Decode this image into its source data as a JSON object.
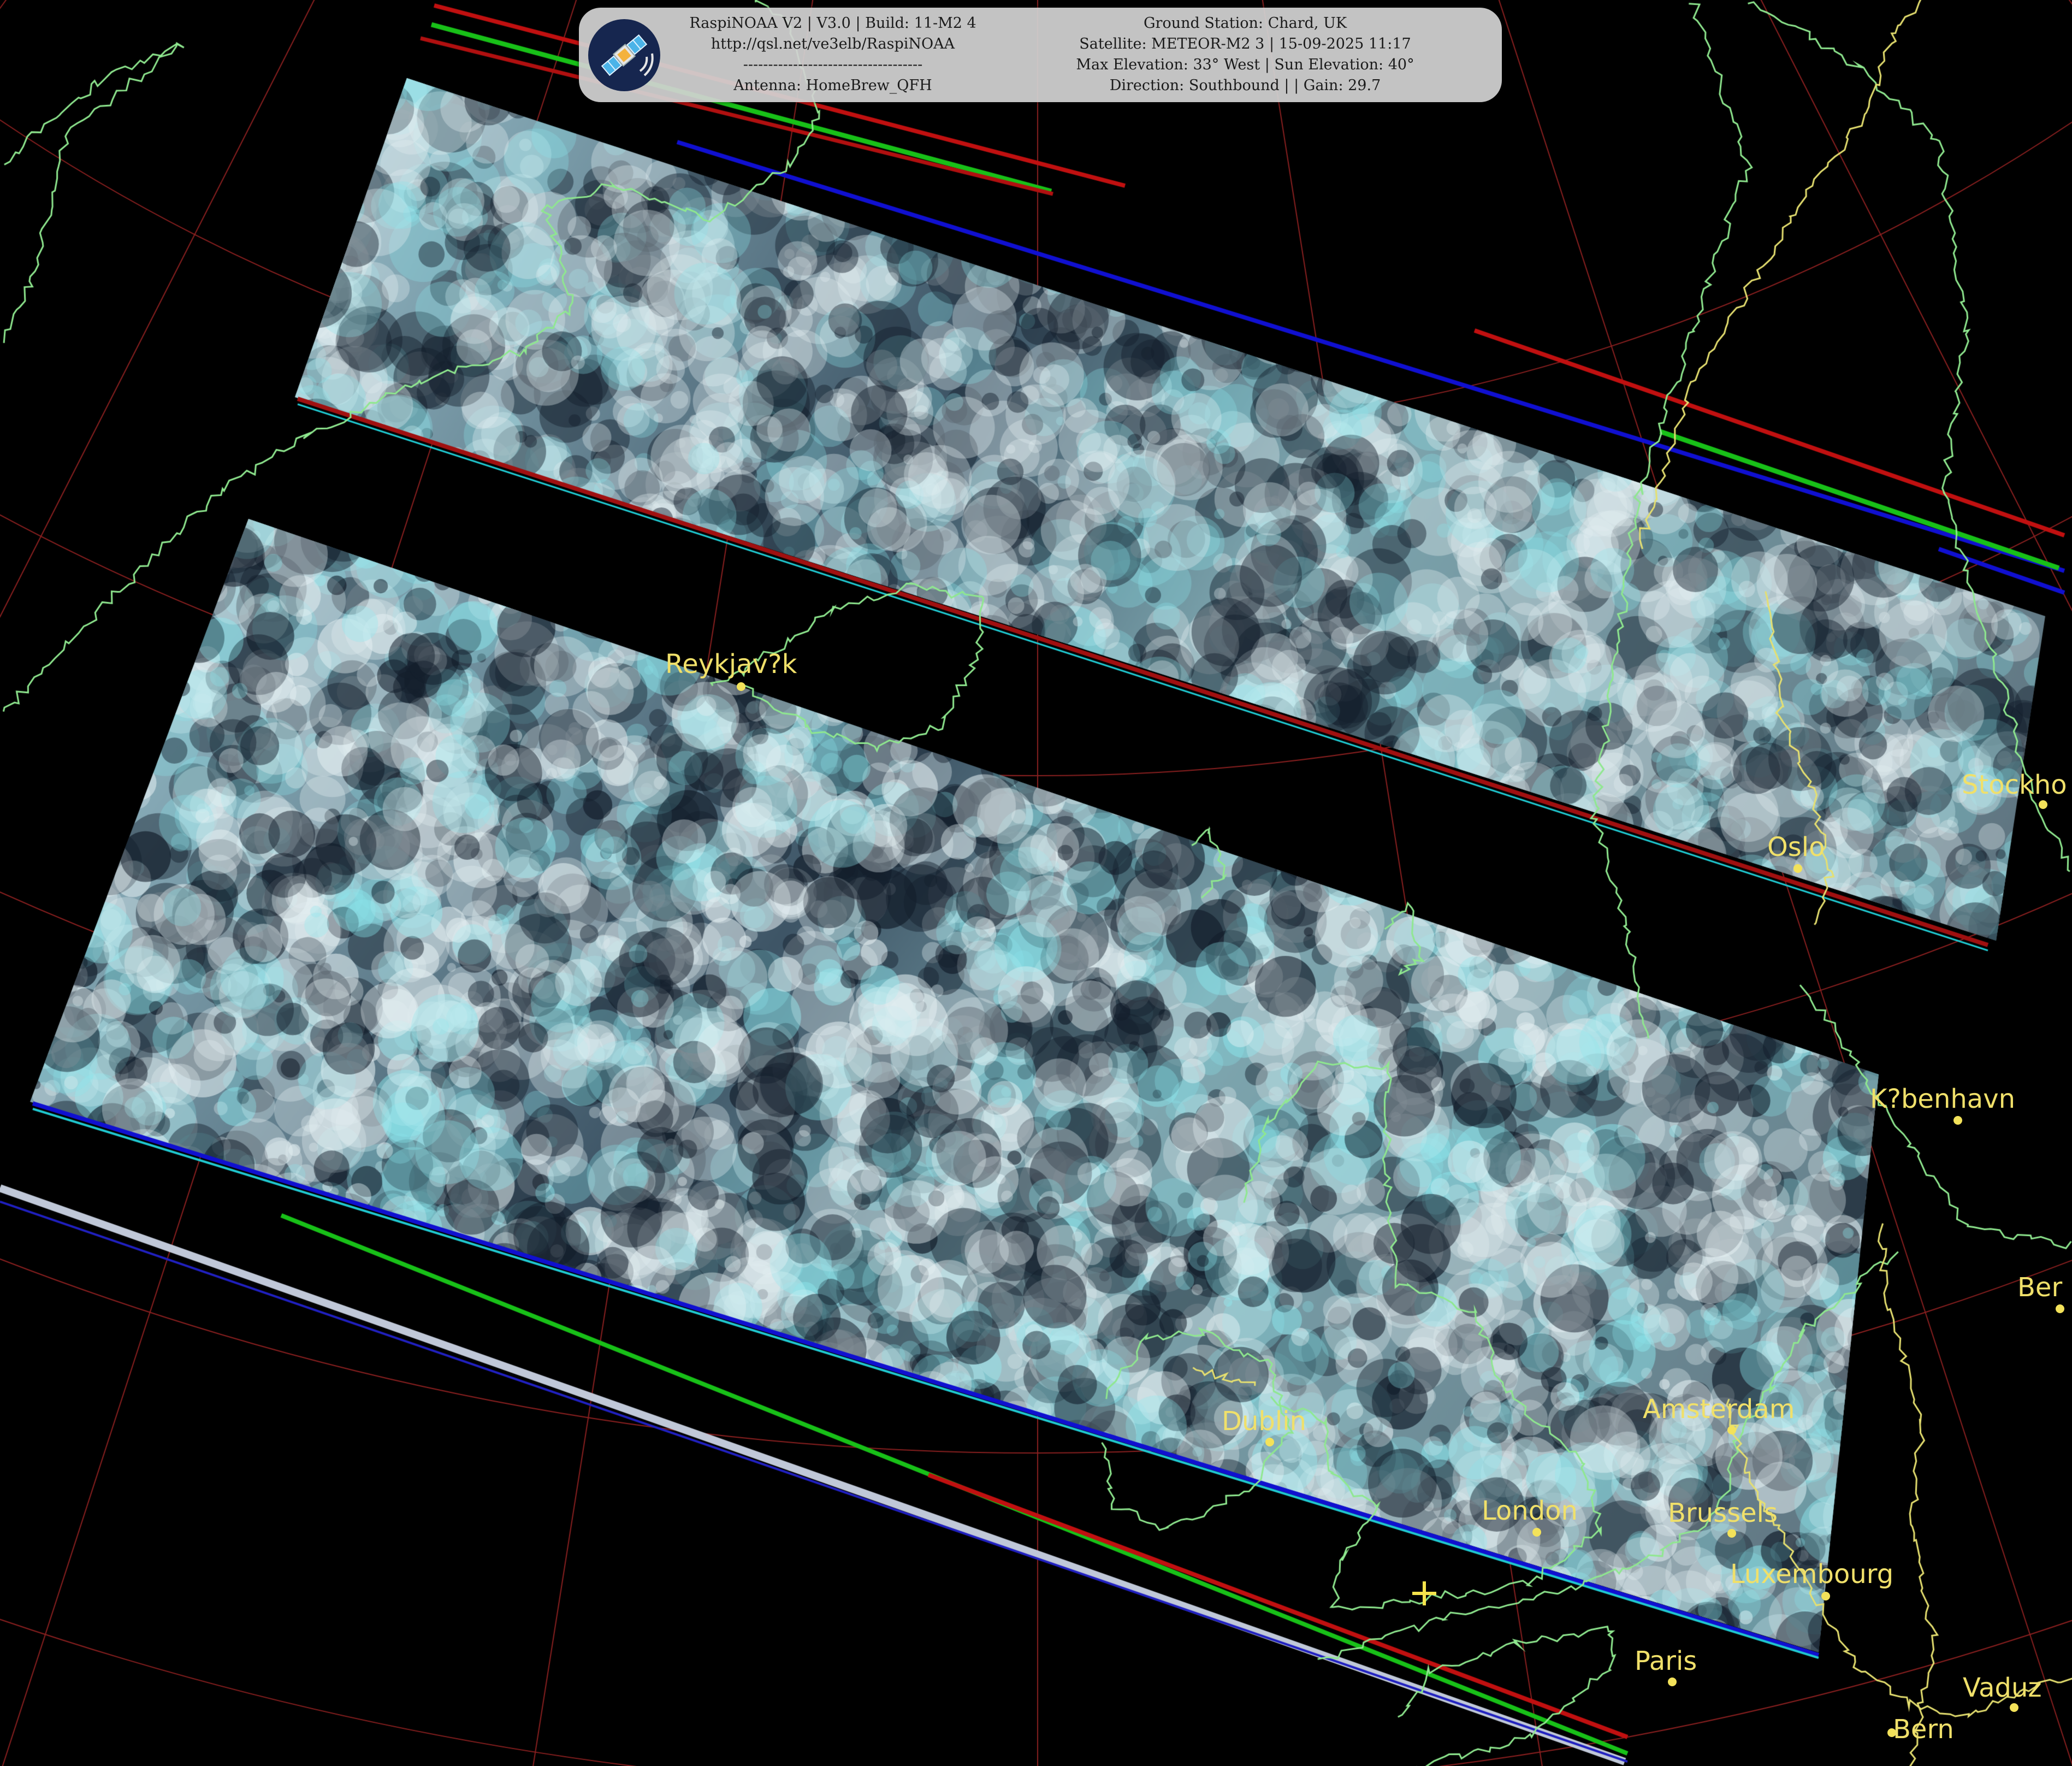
{
  "info_panel": {
    "left_lines": [
      "RaspiNOAA V2 | V3.0 | Build: 11-M2 4",
      "http://qsl.net/ve3elb/RaspiNOAA",
      "------------------------------------",
      "Antenna: HomeBrew_QFH"
    ],
    "right_lines": [
      "Ground Station: Chard, UK",
      "Satellite: METEOR-M2 3 | 15-09-2025 11:17",
      "Max Elevation: 33° West | Sun Elevation: 40°",
      "Direction: Southbound | | Gain: 29.7"
    ],
    "logo_icon": "satellite-icon"
  },
  "cities": [
    {
      "id": "reykjavik",
      "name": "Reykjav?k"
    },
    {
      "id": "stockholm",
      "name": "Stockho"
    },
    {
      "id": "oslo",
      "name": "Oslo"
    },
    {
      "id": "kobenhavn",
      "name": "K?benhavn"
    },
    {
      "id": "berlin",
      "name": "Ber"
    },
    {
      "id": "dublin",
      "name": "Dublin"
    },
    {
      "id": "amsterdam",
      "name": "Amsterdam"
    },
    {
      "id": "london",
      "name": "London"
    },
    {
      "id": "brussels",
      "name": "Brussels"
    },
    {
      "id": "luxembourg",
      "name": "Luxembourg"
    },
    {
      "id": "paris",
      "name": "Paris"
    },
    {
      "id": "vaduz",
      "name": "Vaduz"
    },
    {
      "id": "bern",
      "name": "Bern"
    }
  ],
  "ground_station_marker": "crosshair-icon",
  "colors": {
    "coastline": "#8fe88f",
    "border": "#e6e070",
    "graticule": "#8a2020",
    "city_label": "#f0e06a",
    "panel_bg": "#d2d2d2"
  }
}
